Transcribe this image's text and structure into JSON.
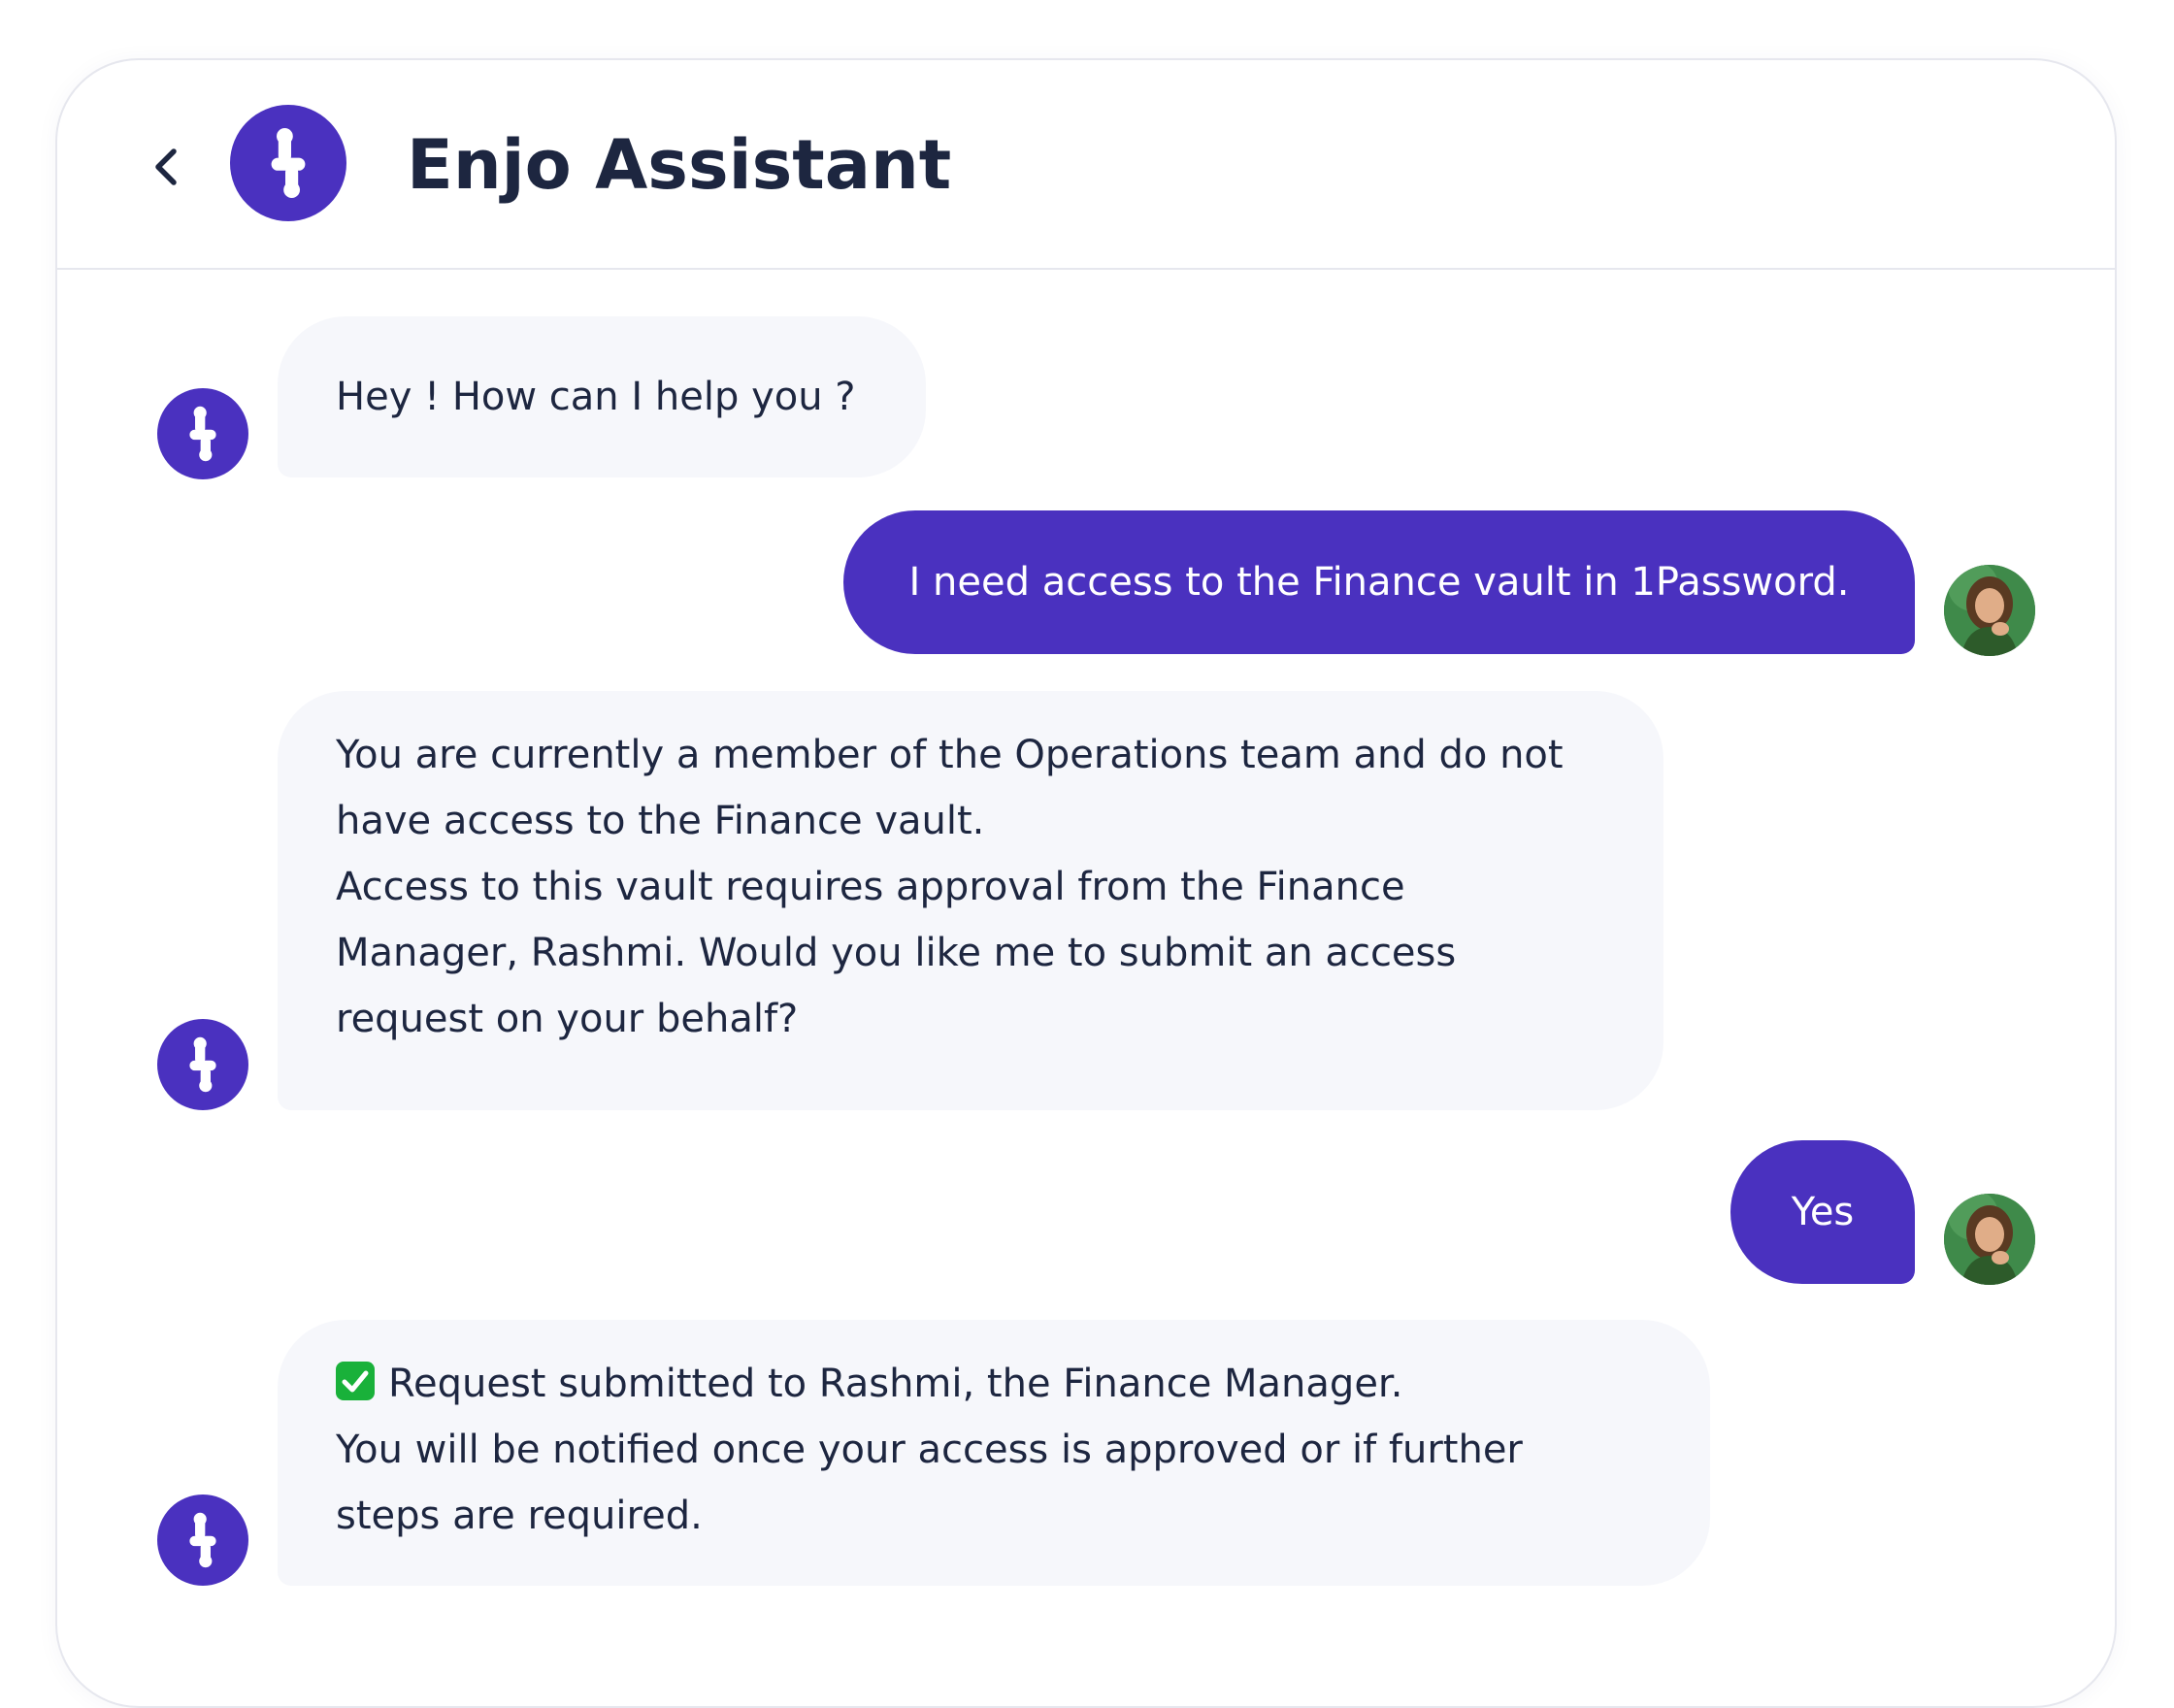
{
  "header": {
    "back_icon": "chevron-left-icon",
    "avatar_icon": "enjo-logo-icon",
    "title": "Enjo Assistant"
  },
  "messages": [
    {
      "sender": "bot",
      "lines": [
        "Hey ! How can I help you ?"
      ]
    },
    {
      "sender": "user",
      "lines": [
        "I need access to the Finance vault in 1Password."
      ]
    },
    {
      "sender": "bot",
      "lines": [
        "You are currently a member of the Operations team and do not",
        "have access to the Finance vault.",
        "Access to this vault requires approval from the Finance",
        "Manager, Rashmi. Would you like me to submit an access",
        "request on your behalf?"
      ]
    },
    {
      "sender": "user",
      "lines": [
        "Yes"
      ]
    },
    {
      "sender": "bot",
      "status_icon": "check-mark-icon",
      "lines": [
        "Request submitted to Rashmi, the Finance Manager.",
        "You will be notified once your access is approved or if further",
        "steps are required."
      ]
    }
  ],
  "colors": {
    "brand": "#4a31bf",
    "bot_bubble": "#f6f7fb",
    "text": "#1d2640",
    "border": "#e6e7ee",
    "success": "#19b13a"
  }
}
